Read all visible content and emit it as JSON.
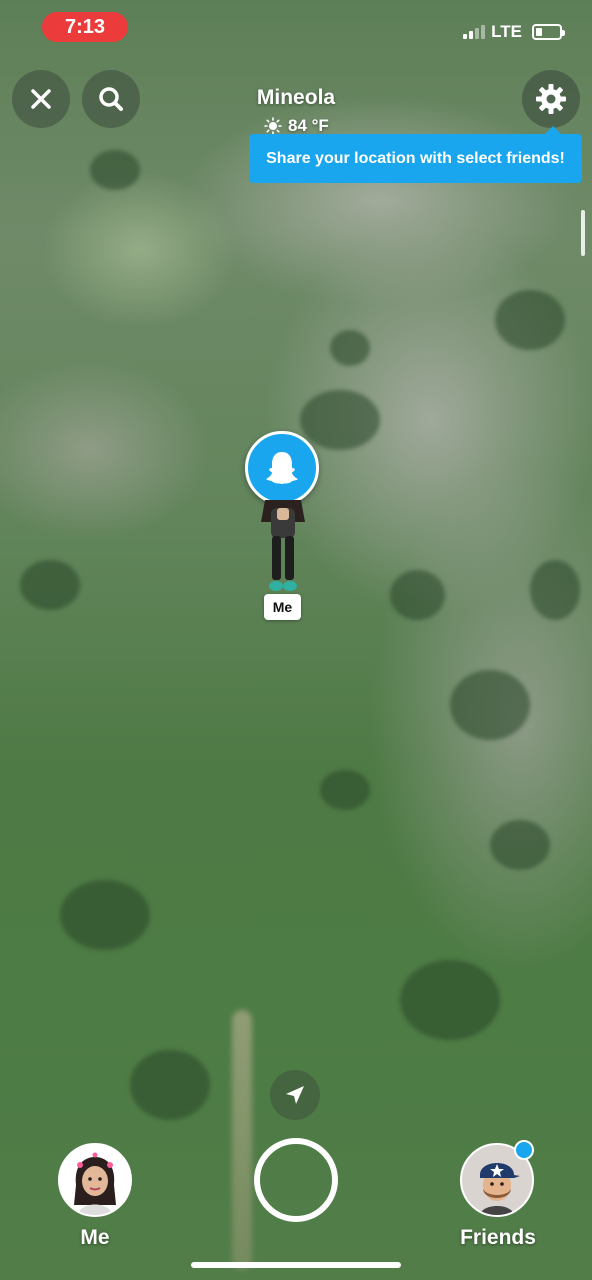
{
  "status_bar": {
    "time": "7:13",
    "network": "LTE",
    "signal_bars": 4,
    "signal_active": 2,
    "battery_level": 0.25
  },
  "header": {
    "place": "Mineola",
    "weather_icon": "sun-icon",
    "temperature": "84 °F"
  },
  "controls": {
    "close_icon": "close-icon",
    "search_icon": "search-icon",
    "settings_icon": "gear-icon",
    "locate_icon": "navigation-arrow-icon"
  },
  "tooltip": {
    "text": "Share your location with select friends!",
    "color": "#1aa6ee"
  },
  "map_marker": {
    "label": "Me",
    "bubble_icon": "ghost-icon"
  },
  "bottom_bar": {
    "me_label": "Me",
    "friends_label": "Friends",
    "friends_notification": true
  },
  "colors": {
    "accent": "#1aa6ee",
    "time_pill": "#ec3b3b"
  }
}
